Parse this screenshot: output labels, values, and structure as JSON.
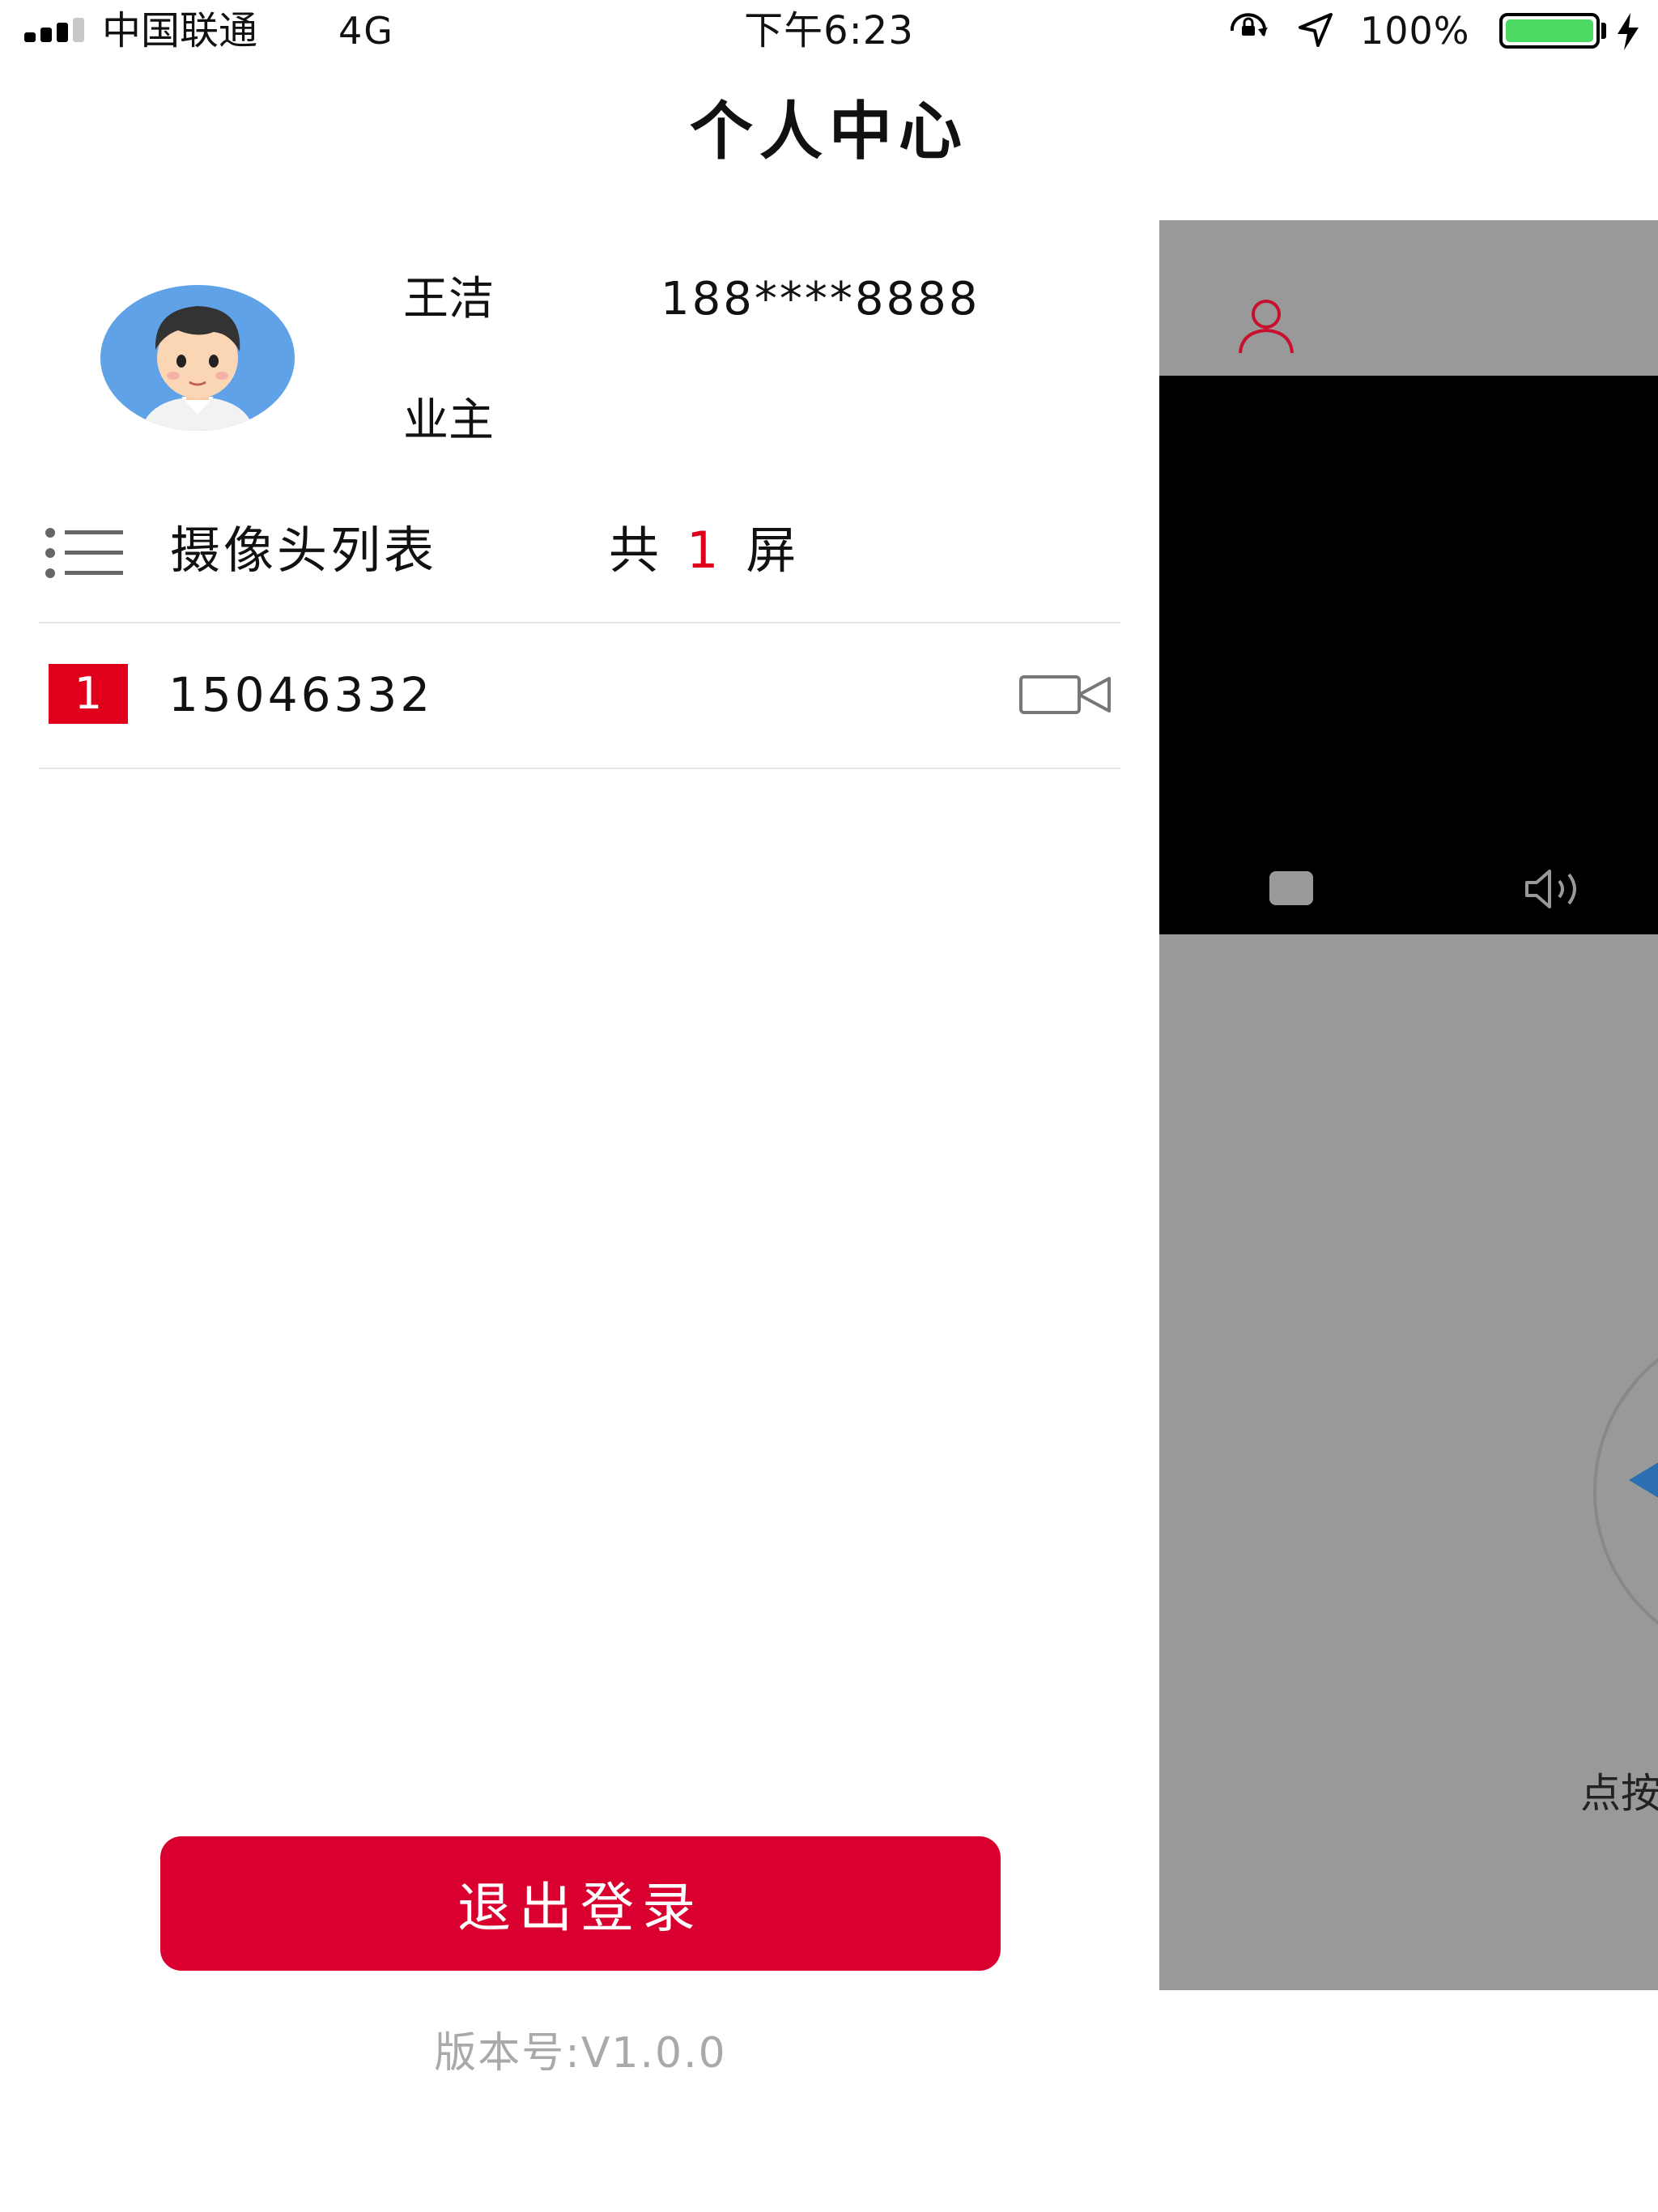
{
  "status_bar": {
    "carrier": "中国联通",
    "network": "4G",
    "time": "下午6:23",
    "battery_percent": "100%",
    "battery_level": 1.0,
    "battery_color": "#4cd964"
  },
  "header": {
    "title": "个人中心"
  },
  "profile": {
    "name": "王洁",
    "phone": "188****8888",
    "role": "业主",
    "avatar_icon": "avatar-icon"
  },
  "camera_list": {
    "title": "摄像头列表",
    "count_prefix": "共",
    "count": "1",
    "count_suffix": "屏",
    "icon": "list-icon",
    "items": [
      {
        "index": "1",
        "id": "15046332",
        "icon": "video-camera-icon"
      }
    ]
  },
  "actions": {
    "logout_label": "退出登录"
  },
  "footer": {
    "version": "版本号:V1.0.0"
  },
  "background_page": {
    "hint_text": "点按",
    "icons": [
      "user-icon",
      "stop-icon",
      "volume-icon",
      "ptz-left-icon"
    ]
  },
  "colors": {
    "accent": "#e0001b",
    "logout_button": "#d9002f",
    "panel_gray": "#999999",
    "version_text": "#a9a9a9"
  }
}
